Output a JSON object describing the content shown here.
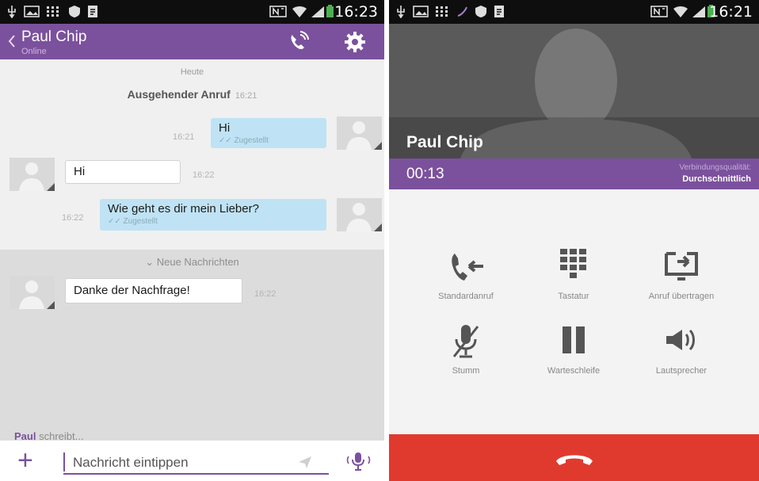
{
  "left": {
    "status_time": "16:23",
    "header": {
      "name": "Paul Chip",
      "status": "Online"
    },
    "day_label": "Heute",
    "outgoing_call": {
      "label": "Ausgehender Anruf",
      "time": "16:21"
    },
    "messages": [
      {
        "text": "Hi",
        "time": "16:21",
        "sub": "Zugestellt"
      },
      {
        "text": "Hi",
        "time": "16:22"
      },
      {
        "text": "Wie geht es dir mein Lieber?",
        "time": "16:22",
        "sub": "Zugestellt"
      }
    ],
    "new_messages_label": "Neue Nachrichten",
    "unread_message": {
      "text": "Danke der Nachfrage!",
      "time": "16:22"
    },
    "typing": {
      "name": "Paul",
      "text": "schreibt..."
    },
    "composer": {
      "placeholder": "Nachricht eintippen"
    }
  },
  "right": {
    "status_time": "16:21",
    "caller_name": "Paul Chip",
    "duration": "00:13",
    "quality_label": "Verbindungsqualität:",
    "quality_value": "Durchschnittlich",
    "actions": [
      {
        "label": "Standardanruf",
        "icon": "standard-call-icon"
      },
      {
        "label": "Tastatur",
        "icon": "keypad-icon"
      },
      {
        "label": "Anruf übertragen",
        "icon": "transfer-call-icon"
      },
      {
        "label": "Stumm",
        "icon": "mute-icon"
      },
      {
        "label": "Warteschleife",
        "icon": "hold-icon"
      },
      {
        "label": "Lautsprecher",
        "icon": "speaker-icon"
      }
    ]
  },
  "colors": {
    "accent": "#7b519d",
    "end_call": "#e03a2f",
    "bubble_out": "#bfe3f4"
  }
}
